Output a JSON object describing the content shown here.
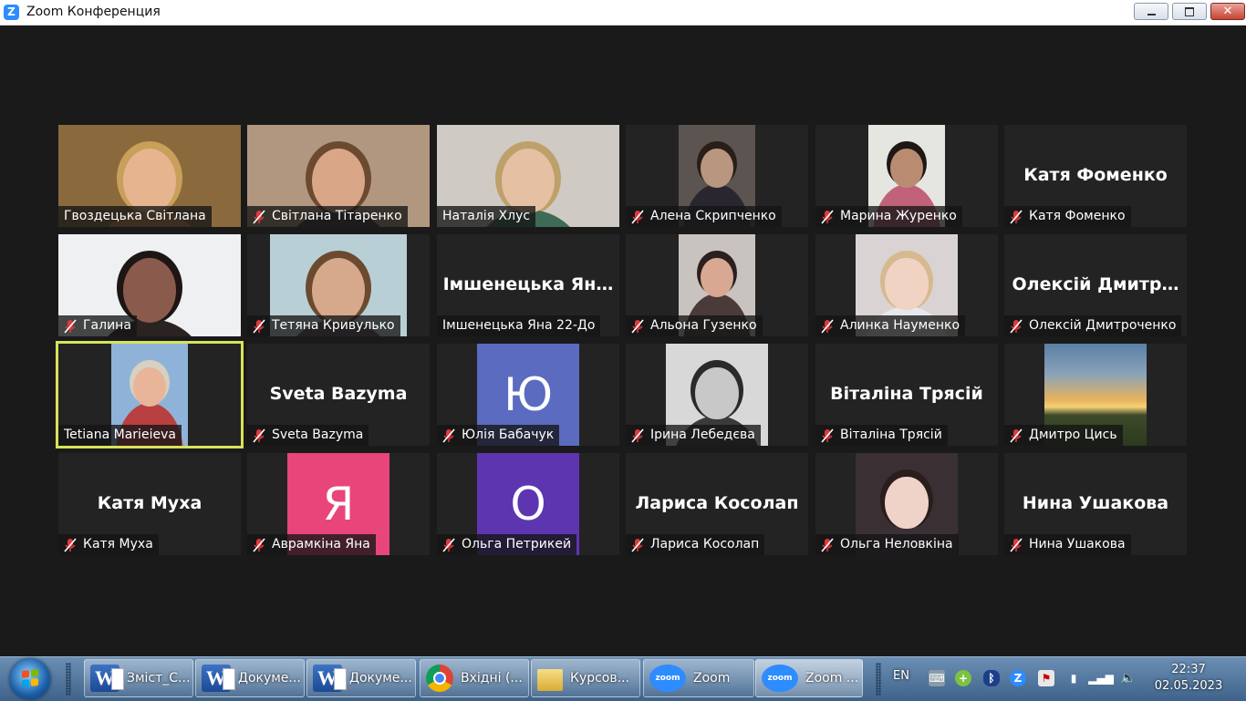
{
  "window": {
    "title": "Zoom Конференция",
    "logo": "Z"
  },
  "colors": {
    "active_speaker_border": "#d7e35a",
    "tile_bg": "#232323",
    "muted_mic": "#e0393e",
    "stage_bg": "#1a1a1a"
  },
  "tiles": [
    {
      "name": "Гвоздецька Світлана",
      "muted": false,
      "display": "video",
      "bg": "#8a6a3c",
      "skin": "#e6b48e",
      "hair": "#c8a05a",
      "cloth": "#c7884a"
    },
    {
      "name": "Світлана Тітаренко",
      "muted": true,
      "display": "video",
      "bg": "#b29780",
      "skin": "#d9a788",
      "hair": "#6b4a30",
      "cloth": "#3a3838"
    },
    {
      "name": "Наталія Хлус",
      "muted": false,
      "display": "video",
      "bg": "#cfcac4",
      "skin": "#e6c0a2",
      "hair": "#bda06a",
      "cloth": "#3d6b55"
    },
    {
      "name": "Алена Скрипченко",
      "muted": true,
      "display": "video",
      "bg": "#5b5450",
      "skin": "#b89680",
      "hair": "#2a1e18",
      "cloth": "#2a2630"
    },
    {
      "name": "Марина Журенко",
      "muted": true,
      "display": "video",
      "bg": "#e6e6e1",
      "skin": "#b98c72",
      "hair": "#1f1714",
      "cloth": "#c0627a"
    },
    {
      "name": "Катя Фоменко",
      "muted": true,
      "display": "name",
      "big": "Катя Фоменко"
    },
    {
      "name": "Галина",
      "muted": true,
      "display": "video",
      "bg": "#eef0f2",
      "skin": "#8a5b4c",
      "hair": "#1e1614",
      "cloth": "#2a2322"
    },
    {
      "name": "Тетяна Кривулько",
      "muted": true,
      "display": "video",
      "bg": "#b9cfd6",
      "skin": "#d6a98c",
      "hair": "#6b4a30",
      "cloth": "#5a4d55"
    },
    {
      "name": "Імшенецька Яна 22-До",
      "muted": false,
      "display": "name",
      "big": "Імшенецька Ян…"
    },
    {
      "name": "Альона Гузенко",
      "muted": true,
      "display": "video",
      "bg": "#c9c3bf",
      "skin": "#d8a892",
      "hair": "#2b2020",
      "cloth": "#4a3a3a"
    },
    {
      "name": "Алинка Науменко",
      "muted": true,
      "display": "video",
      "bg": "#d9d4d3",
      "skin": "#f1d3c4",
      "hair": "#d6b98f",
      "cloth": "#e8e8ec"
    },
    {
      "name": "Олексій Дмитроченко",
      "muted": true,
      "display": "name",
      "big": "Олексій Дмитр…"
    },
    {
      "name": "Tetiana Marieieva",
      "muted": false,
      "display": "video",
      "active": true,
      "bg": "#8fb3d8",
      "skin": "#e8b599",
      "hair": "#d8d0c0",
      "cloth": "#b84040"
    },
    {
      "name": "Sveta Bazyma",
      "muted": true,
      "display": "name",
      "big": "Sveta Bazyma"
    },
    {
      "name": "Юлія Бабачук",
      "muted": true,
      "display": "letter",
      "letter": "Ю",
      "letter_bg": "#5b6bc0"
    },
    {
      "name": "Ірина Лебедєва",
      "muted": true,
      "display": "video",
      "bg": "#d8d8d8",
      "skin": "#c8c8c8",
      "hair": "#2a2a2a",
      "cloth": "#3a3a3a"
    },
    {
      "name": "Віталіна Трясій",
      "muted": true,
      "display": "name",
      "big": "Віталіна Трясій"
    },
    {
      "name": "Дмитро Цись",
      "muted": true,
      "display": "sunset"
    },
    {
      "name": "Катя Муха",
      "muted": true,
      "display": "name",
      "big": "Катя Муха"
    },
    {
      "name": "Аврамкіна Яна",
      "muted": true,
      "display": "letter",
      "letter": "Я",
      "letter_bg": "#e8457b"
    },
    {
      "name": "Ольга Петрикей",
      "muted": true,
      "display": "letter",
      "letter": "О",
      "letter_bg": "#5e35b1"
    },
    {
      "name": "Лариса Косолап",
      "muted": true,
      "display": "name",
      "big": "Лариса Косолап"
    },
    {
      "name": "Ольга Неловкіна",
      "muted": true,
      "display": "video",
      "bg": "#3a3033",
      "skin": "#f0d3c8",
      "hair": "#2a1e1c",
      "cloth": "#3a3036"
    },
    {
      "name": "Нина Ушакова",
      "muted": true,
      "display": "name",
      "big": "Нина Ушакова"
    }
  ],
  "taskbar": {
    "items": [
      {
        "label": "Зміст_С...",
        "icon": "word-icon"
      },
      {
        "label": "Докуме...",
        "icon": "word-icon"
      },
      {
        "label": "Докуме...",
        "icon": "word-icon"
      },
      {
        "label": "Вхідні (...",
        "icon": "chrome-icon"
      },
      {
        "label": "Курсов...",
        "icon": "folder-icon"
      },
      {
        "label": "Zoom",
        "icon": "zoom-icon"
      },
      {
        "label": "Zoom ...",
        "icon": "zoom-icon",
        "active": true
      }
    ],
    "language": "EN",
    "time": "22:37",
    "date": "02.05.2023"
  }
}
